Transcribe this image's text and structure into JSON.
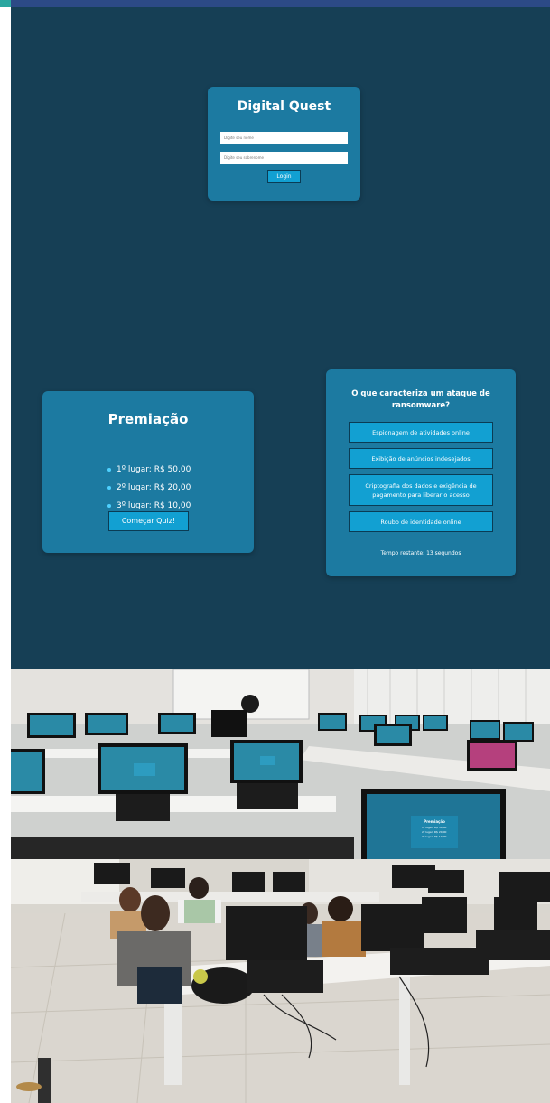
{
  "login": {
    "title": "Digital Quest",
    "name_placeholder": "Digite seu nome",
    "lastname_placeholder": "Digite seu sobrenome",
    "login_button": "Login"
  },
  "prize": {
    "title": "Premiação",
    "items": [
      "1º lugar: R$ 50,00",
      "2º lugar: R$ 20,00",
      "3º lugar: R$ 10,00"
    ],
    "start_button": "Começar Quiz!"
  },
  "quiz": {
    "question": "O que caracteriza um ataque de ransomware?",
    "options": [
      "Espionagem de atividades online",
      "Exibição de anúncios indesejados",
      "Criptografia dos dados e exigência de pagamento para liberar o acesso",
      "Roubo de identidade online"
    ],
    "timer": "Tempo restante: 13 segundos"
  },
  "photo_monitor": {
    "title": "Premiação",
    "items": [
      "1º lugar: R$ 50,00",
      "2º lugar: R$ 20,00",
      "3º lugar: R$ 10,00"
    ]
  },
  "colors": {
    "app_background": "#163f55",
    "card": "#1c7aa1",
    "button": "#12a0d2",
    "header_bar": "#2c4a86"
  }
}
